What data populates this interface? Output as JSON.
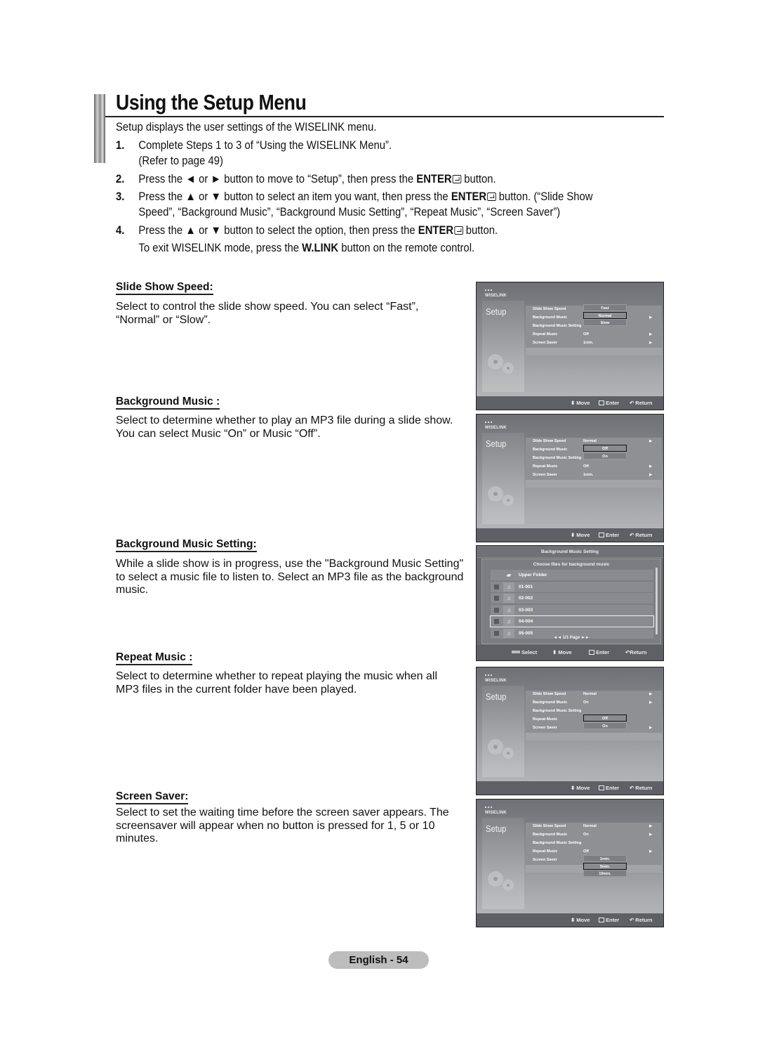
{
  "page": {
    "title": "Using the Setup Menu",
    "intro": "Setup displays the user settings of the WISELINK menu.",
    "steps": [
      {
        "num": "1.",
        "text": "Complete Steps 1 to 3 of “Using the WISELINK Menu”.",
        "cont": "(Refer to page 49)"
      },
      {
        "num": "2.",
        "pre": "Press the ◄ or ► button to move to “Setup”, then press the ",
        "bold": "ENTER",
        "post": " button."
      },
      {
        "num": "3.",
        "pre": "Press the ▲ or ▼ button to select an item you want, then press the ",
        "bold": "ENTER",
        "post": " button. (“Slide Show",
        "cont": "Speed”, “Background Music”, “Background Music Setting”, “Repeat Music”, “Screen Saver”)"
      },
      {
        "num": "4.",
        "pre": "Press the ▲ or ▼ button to select the option, then press the ",
        "bold": "ENTER",
        "post": " button.",
        "cont_pre": "To exit WISELINK mode, press the ",
        "cont_bold": "W.LINK",
        "cont_post": " button on the remote control."
      }
    ],
    "footer_badge": "English - 54"
  },
  "sections": [
    {
      "heading": "Slide Show Speed:",
      "body": "Select to control the slide show speed. You can select “Fast”, “Normal” or “Slow”."
    },
    {
      "heading": "Background Music :",
      "body": "Select to determine whether to play an MP3 file during a slide show. You can select Music “On” or Music “Off”."
    },
    {
      "heading": "Background Music Setting:",
      "body": "While a slide show is in progress, use the \"Background Music Setting\" to select a music file to listen to. Select an MP3 file as the background music."
    },
    {
      "heading": "Repeat Music :",
      "body": "Select to determine whether to repeat playing the music when all MP3 files in the current folder have been played."
    },
    {
      "heading": "Screen Saver:",
      "body": "Select to set the waiting time before the screen saver appears. The screensaver will appear when no button is pressed for 1, 5 or 10 minutes."
    }
  ],
  "tv": {
    "logo": "WISELINK",
    "setup_label": "Setup",
    "menu_labels": [
      "Slide Show Speed",
      "Background Music",
      "Background Music Setting",
      "Repeat Music",
      "Screen Saver"
    ],
    "footer": {
      "move": "Move",
      "enter": "Enter",
      "return": "Return",
      "select": "Select"
    },
    "screens": [
      {
        "values": [
          "",
          "",
          "",
          "Off",
          "1min."
        ],
        "arrows": [
          false,
          true,
          false,
          true,
          true
        ],
        "popup_row": 0,
        "popup": [
          "Fast",
          "Normal",
          "Slow"
        ],
        "popup_selected": 1
      },
      {
        "values": [
          "Normal",
          "",
          "",
          "Off",
          "1min."
        ],
        "arrows": [
          true,
          false,
          false,
          true,
          true
        ],
        "popup_row": 1,
        "popup": [
          "Off",
          "On"
        ],
        "popup_selected": 0
      },
      {
        "values": [
          "Normal",
          "On",
          "",
          "",
          ""
        ],
        "arrows": [
          true,
          true,
          false,
          false,
          true
        ],
        "popup_row": 3,
        "popup": [
          "Off",
          "On"
        ],
        "popup_selected": 0
      },
      {
        "values": [
          "Normal",
          "On",
          "",
          "Off",
          ""
        ],
        "arrows": [
          true,
          true,
          false,
          true,
          false
        ],
        "popup_row": 4,
        "popup": [
          "1min.",
          "5min.",
          "10min."
        ],
        "popup_selected": 1
      }
    ],
    "bgm": {
      "title": "Background Music Setting",
      "subtitle": "Choose files for background music",
      "upper_folder": "Upper Folder",
      "files": [
        "01-001",
        "02-002",
        "03-003",
        "04-004",
        "05-005"
      ],
      "selected_index": 3,
      "pager": "◄◄ 1/1 Page ►►"
    }
  }
}
